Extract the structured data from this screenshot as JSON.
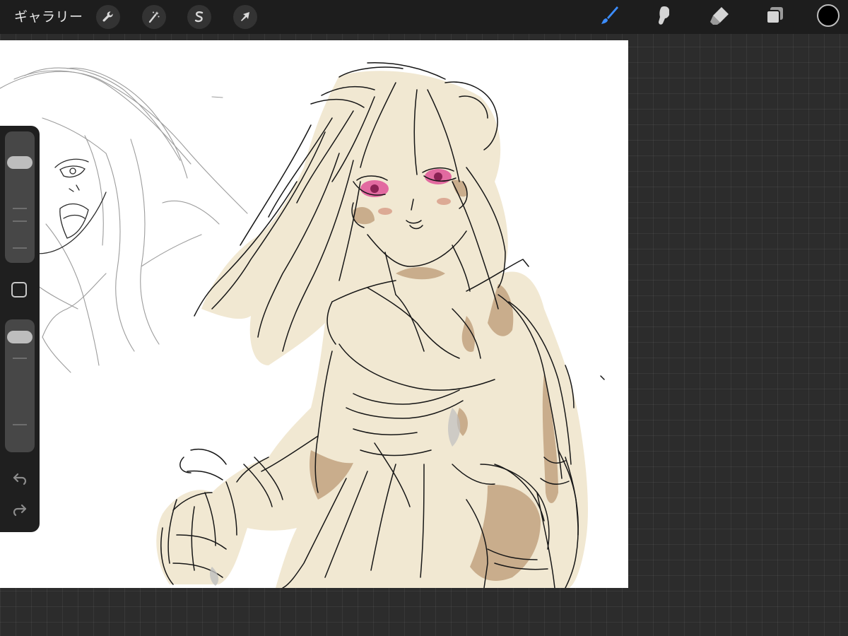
{
  "toolbar": {
    "gallery_label": "ギャラリー",
    "left_tools": [
      "wrench-icon",
      "magic-wand-icon",
      "selection-icon",
      "transform-arrow-icon"
    ],
    "right_tools": [
      "brush-icon",
      "smudge-icon",
      "eraser-icon",
      "layers-icon"
    ],
    "active_tool": "brush-icon",
    "active_color": "#000000",
    "accent_color": "#3c8dff"
  },
  "sidebar": {
    "brush_size_level": 0.2,
    "opacity_level": 0.08,
    "controls": [
      "brush-size-slider",
      "modify-button",
      "opacity-slider",
      "undo-icon",
      "redo-icon"
    ]
  },
  "canvas": {
    "background_color": "#ffffff",
    "fill_color": "#f1e8d2",
    "shadow_color": "#c7ab8a",
    "eye_color": "#e26aa0"
  }
}
